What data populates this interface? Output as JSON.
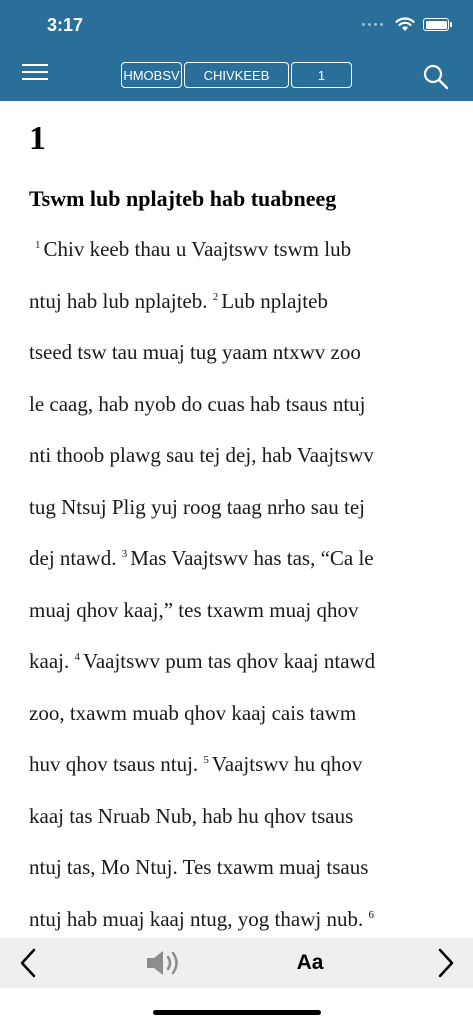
{
  "status": {
    "time": "3:17"
  },
  "nav": {
    "version": "HMOBSV",
    "book": "CHIVKEEB",
    "chapter": "1"
  },
  "chapter": {
    "number": "1",
    "heading": "Tswm lub nplajteb hab tuabneeg",
    "lines": [
      {
        "verse": "1",
        "text": "Chiv keeb thau u Vaajtswv tswm lub"
      },
      {
        "verse": "",
        "text": "ntuj hab lub nplajteb.",
        "verse2": "2",
        "text2": "Lub nplajteb"
      },
      {
        "verse": "",
        "text": "tseed tsw tau muaj tug yaam ntxwv zoo"
      },
      {
        "verse": "",
        "text": "le caag, hab nyob do cuas hab tsaus ntuj"
      },
      {
        "verse": "",
        "text": "nti thoob plawg sau tej dej, hab Vaajtswv"
      },
      {
        "verse": "",
        "text": "tug Ntsuj Plig yuj roog taag nrho sau tej"
      },
      {
        "verse": "",
        "text": "dej ntawd.",
        "verse2": "3",
        "text2": "Mas Vaajtswv has tas, “Ca le"
      },
      {
        "verse": "",
        "text": "muaj qhov kaaj,” tes txawm muaj qhov"
      },
      {
        "verse": "",
        "text": "kaaj.",
        "verse2": "4",
        "text2": "Vaajtswv pum tas qhov kaaj ntawd"
      },
      {
        "verse": "",
        "text": "zoo, txawm muab qhov kaaj cais tawm"
      },
      {
        "verse": "",
        "text": "huv qhov tsaus ntuj.",
        "verse2": "5",
        "text2": "Vaajtswv hu qhov"
      },
      {
        "verse": "",
        "text": "kaaj tas Nruab Nub, hab hu qhov tsaus"
      },
      {
        "verse": "",
        "text": "ntuj tas, Mo Ntuj. Tes txawm muaj tsaus"
      },
      {
        "verse": "",
        "text": "ntuj hab muaj kaaj ntug, yog thawj nub.",
        "verse2": "6",
        "text2": ""
      }
    ]
  },
  "toolbar": {
    "font_label": "Aa"
  },
  "colors": {
    "header": "#2a6f99",
    "toolbar": "#efefef"
  },
  "icons": [
    "menu-icon",
    "search-icon",
    "wifi-icon",
    "battery-icon",
    "chevron-left-icon",
    "speaker-icon",
    "chevron-right-icon"
  ]
}
